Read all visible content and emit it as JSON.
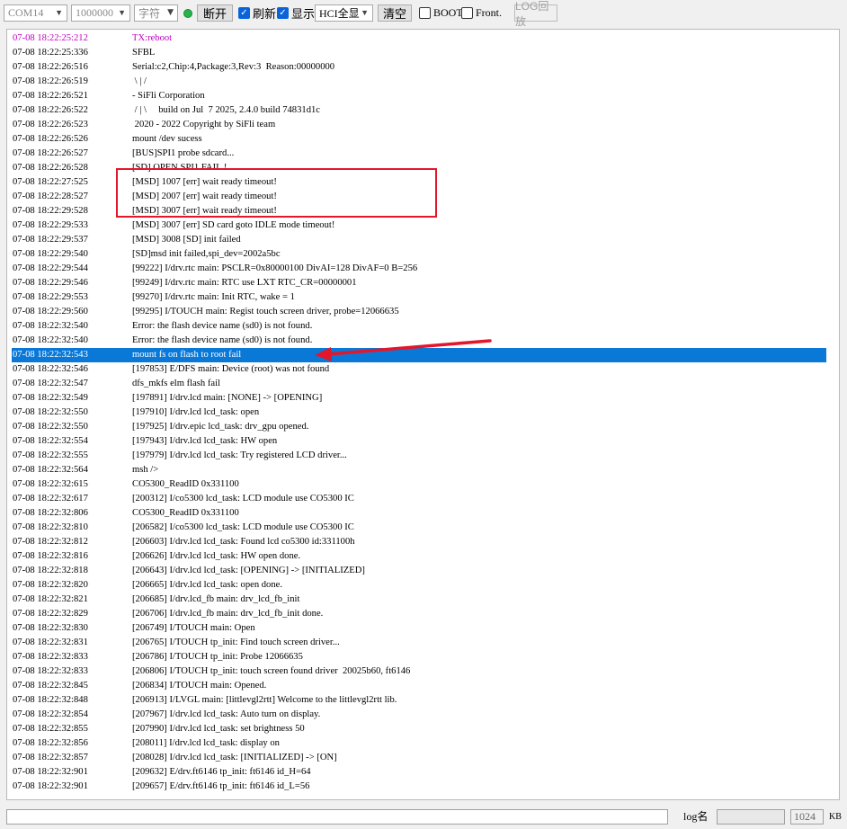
{
  "toolbar": {
    "port": "COM14",
    "baud": "1000000",
    "encoding": "字符",
    "disconnect_label": "断开",
    "refresh_label": "刷新",
    "display_label": "显示",
    "display_mode": "HCI全显",
    "clear_label": "清空",
    "boot_label": "BOOT",
    "front_label": "Front.",
    "log_replay_label": "LOG回放",
    "status_color": "#27b24a"
  },
  "log_lines": [
    {
      "ts": "07-08 18:22:25:212",
      "msg": "TX:reboot",
      "kind": "tx"
    },
    {
      "ts": "07-08 18:22:25:336",
      "msg": "SFBL"
    },
    {
      "ts": "07-08 18:22:26:516",
      "msg": "Serial:c2,Chip:4,Package:3,Rev:3  Reason:00000000"
    },
    {
      "ts": "07-08 18:22:26:519",
      "msg": " \\ | /"
    },
    {
      "ts": "07-08 18:22:26:521",
      "msg": "- SiFli Corporation"
    },
    {
      "ts": "07-08 18:22:26:522",
      "msg": " / | \\     build on Jul  7 2025, 2.4.0 build 74831d1c"
    },
    {
      "ts": "07-08 18:22:26:523",
      "msg": " 2020 - 2022 Copyright by SiFli team"
    },
    {
      "ts": "07-08 18:22:26:526",
      "msg": "mount /dev sucess"
    },
    {
      "ts": "07-08 18:22:26:527",
      "msg": "[BUS]SPI1 probe sdcard..."
    },
    {
      "ts": "07-08 18:22:26:528",
      "msg": "[SD] OPEN SPI1 FAIL !"
    },
    {
      "ts": "07-08 18:22:27:525",
      "msg": "[MSD] 1007 [err] wait ready timeout!"
    },
    {
      "ts": "07-08 18:22:28:527",
      "msg": "[MSD] 2007 [err] wait ready timeout!"
    },
    {
      "ts": "07-08 18:22:29:528",
      "msg": "[MSD] 3007 [err] wait ready timeout!"
    },
    {
      "ts": "07-08 18:22:29:533",
      "msg": "[MSD] 3007 [err] SD card goto IDLE mode timeout!"
    },
    {
      "ts": "07-08 18:22:29:537",
      "msg": "[MSD] 3008 [SD] init failed"
    },
    {
      "ts": "07-08 18:22:29:540",
      "msg": "[SD]msd init failed,spi_dev=2002a5bc"
    },
    {
      "ts": "07-08 18:22:29:544",
      "msg": "[99222] I/drv.rtc main: PSCLR=0x80000100 DivAI=128 DivAF=0 B=256"
    },
    {
      "ts": "07-08 18:22:29:546",
      "msg": "[99249] I/drv.rtc main: RTC use LXT RTC_CR=00000001"
    },
    {
      "ts": "07-08 18:22:29:553",
      "msg": "[99270] I/drv.rtc main: Init RTC, wake = 1"
    },
    {
      "ts": "07-08 18:22:29:560",
      "msg": "[99295] I/TOUCH main: Regist touch screen driver, probe=12066635"
    },
    {
      "ts": "07-08 18:22:32:540",
      "msg": "Error: the flash device name (sd0) is not found."
    },
    {
      "ts": "07-08 18:22:32:540",
      "msg": "Error: the flash device name (sd0) is not found."
    },
    {
      "ts": "07-08 18:22:32:543",
      "msg": "mount fs on flash to root fail",
      "kind": "selected"
    },
    {
      "ts": "07-08 18:22:32:546",
      "msg": "[197853] E/DFS main: Device (root) was not found"
    },
    {
      "ts": "07-08 18:22:32:547",
      "msg": "dfs_mkfs elm flash fail"
    },
    {
      "ts": "07-08 18:22:32:549",
      "msg": "[197891] I/drv.lcd main: [NONE] -> [OPENING]"
    },
    {
      "ts": "07-08 18:22:32:550",
      "msg": "[197910] I/drv.lcd lcd_task: open"
    },
    {
      "ts": "07-08 18:22:32:550",
      "msg": "[197925] I/drv.epic lcd_task: drv_gpu opened."
    },
    {
      "ts": "07-08 18:22:32:554",
      "msg": "[197943] I/drv.lcd lcd_task: HW open"
    },
    {
      "ts": "07-08 18:22:32:555",
      "msg": "[197979] I/drv.lcd lcd_task: Try registered LCD driver..."
    },
    {
      "ts": "07-08 18:22:32:564",
      "msg": "msh />"
    },
    {
      "ts": "07-08 18:22:32:615",
      "msg": "CO5300_ReadID 0x331100"
    },
    {
      "ts": "07-08 18:22:32:617",
      "msg": "[200312] I/co5300 lcd_task: LCD module use CO5300 IC"
    },
    {
      "ts": "07-08 18:22:32:806",
      "msg": "CO5300_ReadID 0x331100"
    },
    {
      "ts": "07-08 18:22:32:810",
      "msg": "[206582] I/co5300 lcd_task: LCD module use CO5300 IC"
    },
    {
      "ts": "07-08 18:22:32:812",
      "msg": "[206603] I/drv.lcd lcd_task: Found lcd co5300 id:331100h"
    },
    {
      "ts": "07-08 18:22:32:816",
      "msg": "[206626] I/drv.lcd lcd_task: HW open done."
    },
    {
      "ts": "07-08 18:22:32:818",
      "msg": "[206643] I/drv.lcd lcd_task: [OPENING] -> [INITIALIZED]"
    },
    {
      "ts": "07-08 18:22:32:820",
      "msg": "[206665] I/drv.lcd lcd_task: open done."
    },
    {
      "ts": "07-08 18:22:32:821",
      "msg": "[206685] I/drv.lcd_fb main: drv_lcd_fb_init"
    },
    {
      "ts": "07-08 18:22:32:829",
      "msg": "[206706] I/drv.lcd_fb main: drv_lcd_fb_init done."
    },
    {
      "ts": "07-08 18:22:32:830",
      "msg": "[206749] I/TOUCH main: Open"
    },
    {
      "ts": "07-08 18:22:32:831",
      "msg": "[206765] I/TOUCH tp_init: Find touch screen driver..."
    },
    {
      "ts": "07-08 18:22:32:833",
      "msg": "[206786] I/TOUCH tp_init: Probe 12066635"
    },
    {
      "ts": "07-08 18:22:32:833",
      "msg": "[206806] I/TOUCH tp_init: touch screen found driver  20025b60, ft6146"
    },
    {
      "ts": "07-08 18:22:32:845",
      "msg": "[206834] I/TOUCH main: Opened."
    },
    {
      "ts": "07-08 18:22:32:848",
      "msg": "[206913] I/LVGL main: [littlevgl2rtt] Welcome to the littlevgl2rtt lib."
    },
    {
      "ts": "07-08 18:22:32:854",
      "msg": "[207967] I/drv.lcd lcd_task: Auto turn on display."
    },
    {
      "ts": "07-08 18:22:32:855",
      "msg": "[207990] I/drv.lcd lcd_task: set brightness 50"
    },
    {
      "ts": "07-08 18:22:32:856",
      "msg": "[208011] I/drv.lcd lcd_task: display on"
    },
    {
      "ts": "07-08 18:22:32:857",
      "msg": "[208028] I/drv.lcd lcd_task: [INITIALIZED] -> [ON]"
    },
    {
      "ts": "07-08 18:22:32:901",
      "msg": "[209632] E/drv.ft6146 tp_init: ft6146 id_H=64"
    },
    {
      "ts": "07-08 18:22:32:901",
      "msg": "[209657] E/drv.ft6146 tp_init: ft6146 id_L=56"
    }
  ],
  "annotations": {
    "highlight_color": "#e4162a",
    "selection_color": "#0a78d7"
  },
  "statusbar": {
    "input_value": "",
    "log_name_label": "log名",
    "log_name_value": "",
    "size_value": "1024",
    "size_unit": "KB"
  }
}
